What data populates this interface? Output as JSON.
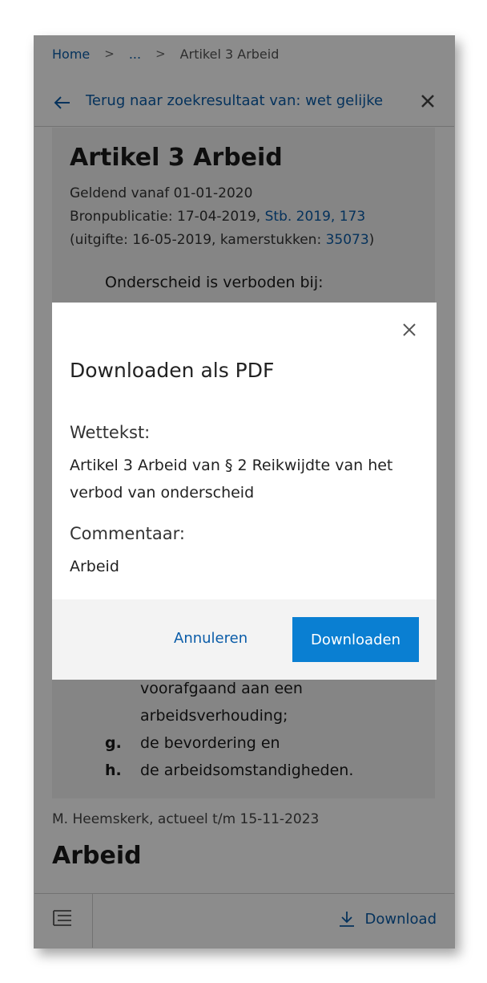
{
  "breadcrumb": {
    "home": "Home",
    "ellipsis": "...",
    "current": "Artikel 3 Arbeid"
  },
  "header": {
    "back_text": "Terug naar zoekresultaat van: wet gelijke"
  },
  "article": {
    "title": "Artikel 3 Arbeid",
    "valid_from": "Geldend vanaf 01-01-2020",
    "source_prefix": "Bronpublicatie: 17-04-2019, ",
    "source_link": "Stb. 2019, 173",
    "issue_prefix": "(uitgifte: 16-05-2019, kamerstukken: ",
    "issue_link": "35073",
    "issue_suffix": ")",
    "lead": "Onderscheid is verboden bij:",
    "items": [
      {
        "letter": "",
        "text": "voorafgaand aan een"
      },
      {
        "letter": "",
        "text": "arbeidsverhouding;"
      },
      {
        "letter": "g.",
        "text": "de bevordering en"
      },
      {
        "letter": "h.",
        "text": "de arbeidsomstandigheden."
      }
    ]
  },
  "commentary": {
    "author": "M. Heemskerk, actueel t/m 15-11-2023",
    "title": "Arbeid"
  },
  "bottom_bar": {
    "download_label": "Download"
  },
  "modal": {
    "title": "Downloaden als PDF",
    "law_label": "Wettekst:",
    "law_value": "Artikel 3 Arbeid van § 2 Reikwijdte van het verbod van onderscheid",
    "comment_label": "Commentaar:",
    "comment_value": "Arbeid",
    "cancel_label": "Annuleren",
    "download_label": "Downloaden"
  },
  "colors": {
    "link": "#0a5ca8",
    "primary": "#0a7fd2"
  }
}
